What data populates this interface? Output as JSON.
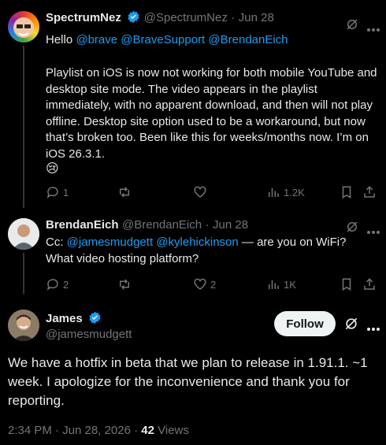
{
  "tweet1": {
    "name": "SpectrumNez",
    "handle": "@SpectrumNez",
    "sep": "·",
    "date": "Jun 28",
    "greeting": "Hello",
    "mentions": [
      "@brave",
      "@BraveSupport",
      "@BrendanEich"
    ],
    "body": "Playlist on iOS is now not working for both mobile YouTube and desktop site mode. The video appears in the playlist immediately, with no apparent download, and then will not play offline. Desktop site option used to be a workaround, but now that’s broken too. Been like this for weeks/months now. I’m on iOS 26.3.1.",
    "emoji": "😢",
    "replies": "1",
    "retweets": "",
    "likes": "",
    "views": "1.2K"
  },
  "tweet2": {
    "name": "BrendanEich",
    "handle": "@BrendanEich",
    "sep": "·",
    "date": "Jun 28",
    "prefix": "Cc:",
    "mention1": "@jamesmudgett",
    "mention2": "@kylehickinson",
    "text_after": "— are you on WiFi?",
    "line2": "What video hosting platform?",
    "replies": "2",
    "retweets": "",
    "likes": "2",
    "views": "1K"
  },
  "main": {
    "name": "James",
    "handle": "@jamesmudgett",
    "follow_label": "Follow",
    "body": "We have a hotfix in beta that we plan to release in 1.91.1. ~1 week. I apologize for the inconvenience and thank you for reporting.",
    "time": "2:34 PM · Jun 28, 2026 ·",
    "views_count": "42",
    "views_label": "Views"
  },
  "colors": {
    "accent": "#1d9bf0",
    "muted": "#71767b",
    "text": "#e7e9ea",
    "background": "#000000"
  }
}
